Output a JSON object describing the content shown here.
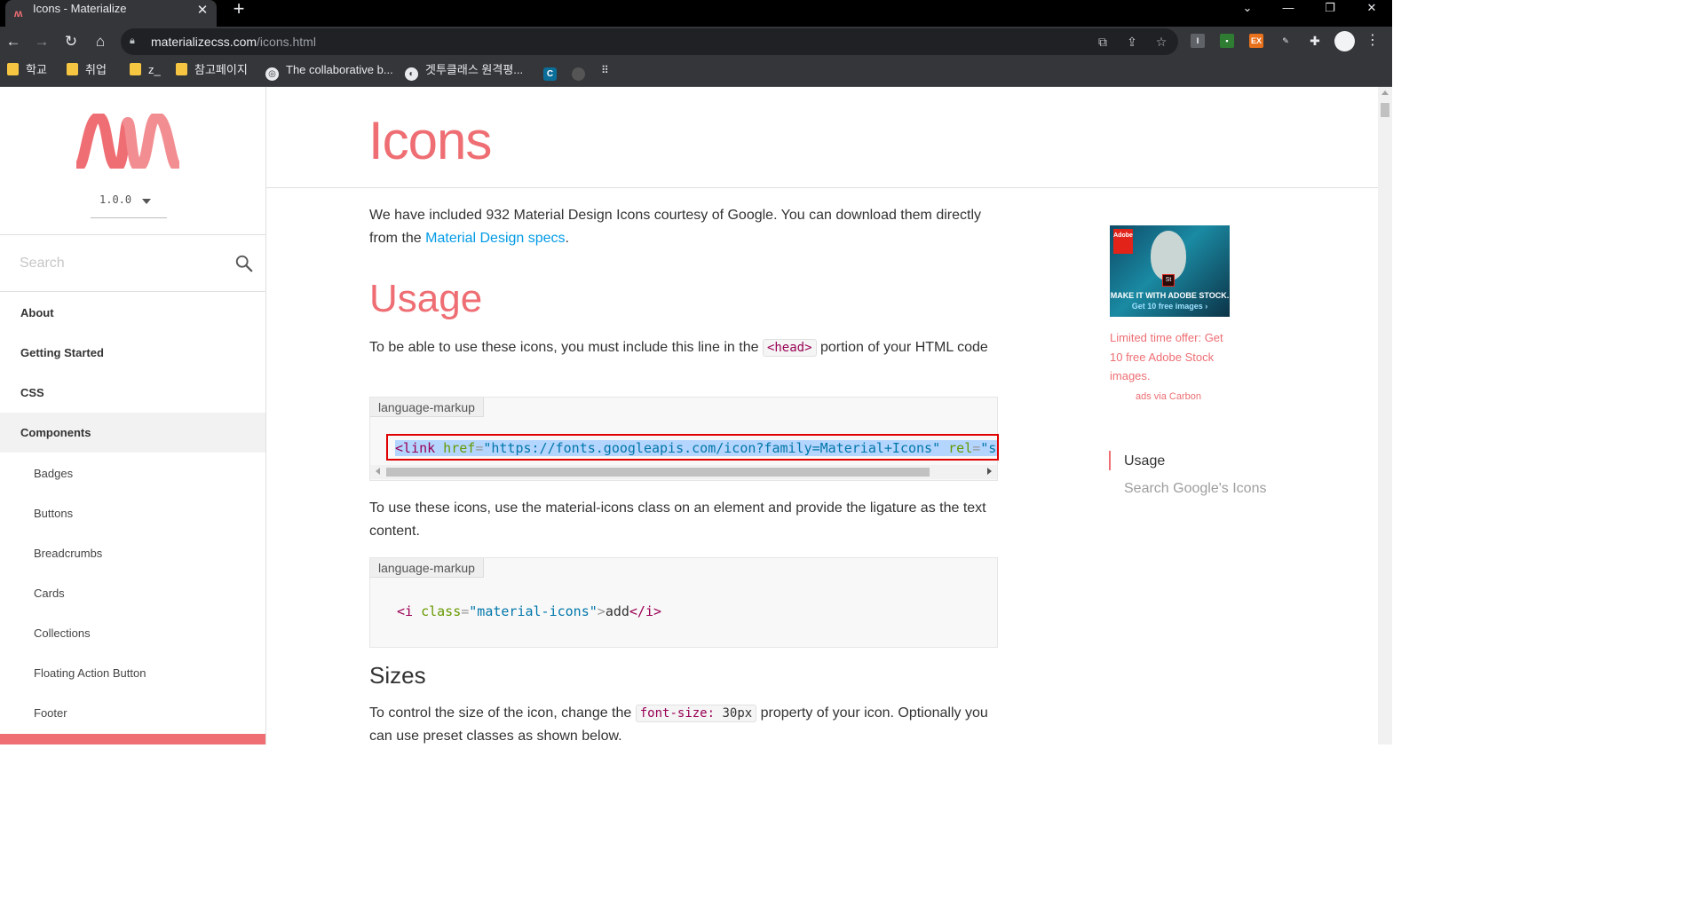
{
  "browser": {
    "tab_title": "Icons - Materialize",
    "url_host": "materializecss.com",
    "url_path": "/icons.html",
    "bookmarks": [
      "학교",
      "취업",
      "z_",
      "참고페이지",
      "The collaborative b...",
      "겟투클래스 원격평..."
    ]
  },
  "sidebar": {
    "version": "1.0.0",
    "search_placeholder": "Search",
    "nav_top": [
      "About",
      "Getting Started",
      "CSS",
      "Components"
    ],
    "nav_sub": [
      "Badges",
      "Buttons",
      "Breadcrumbs",
      "Cards",
      "Collections",
      "Floating Action Button",
      "Footer"
    ]
  },
  "main": {
    "title": "Icons",
    "intro_text": "We have included 932 Material Design Icons courtesy of Google. You can download them directly from the ",
    "intro_link": "Material Design specs",
    "intro_end": ".",
    "usage_heading": "Usage",
    "usage_text_before": "To be able to use these icons, you must include this line in the ",
    "usage_inline_code": "<head>",
    "usage_text_after": " portion of your HTML code",
    "code1": {
      "lang": "language-markup",
      "open": "<link",
      "attr1": " href",
      "eq1": "=",
      "val1": "\"https://fonts.googleapis.com/icon?family=Material+Icons\"",
      "attr2": " rel",
      "eq2": "=",
      "val2": "\"styles"
    },
    "use_text": "To use these icons, use the material-icons class on an element and provide the ligature as the text content.",
    "code2": {
      "lang": "language-markup",
      "open": "<i",
      "attr": " class",
      "eq": "=",
      "val": "\"material-icons\"",
      "gt": ">",
      "content": "add",
      "close": "</i>"
    },
    "sizes_heading": "Sizes",
    "sizes_text_before": "To control the size of the icon, change the ",
    "sizes_code_prop": "font-size:",
    "sizes_code_val": " 30px",
    "sizes_text_after": " property of your icon. Optionally you can use preset classes as shown below."
  },
  "ad": {
    "headline": "MAKE IT WITH ADOBE STOCK.",
    "cta": "Get 10 free images ›",
    "brand": "Adobe",
    "badge": "St",
    "text": "Limited time offer: Get 10 free Adobe Stock images.",
    "via": "ads via Carbon"
  },
  "toc": {
    "items": [
      "Usage",
      "Search Google's Icons"
    ]
  },
  "colors": {
    "accent": "#ee6e73",
    "link": "#039be5"
  }
}
